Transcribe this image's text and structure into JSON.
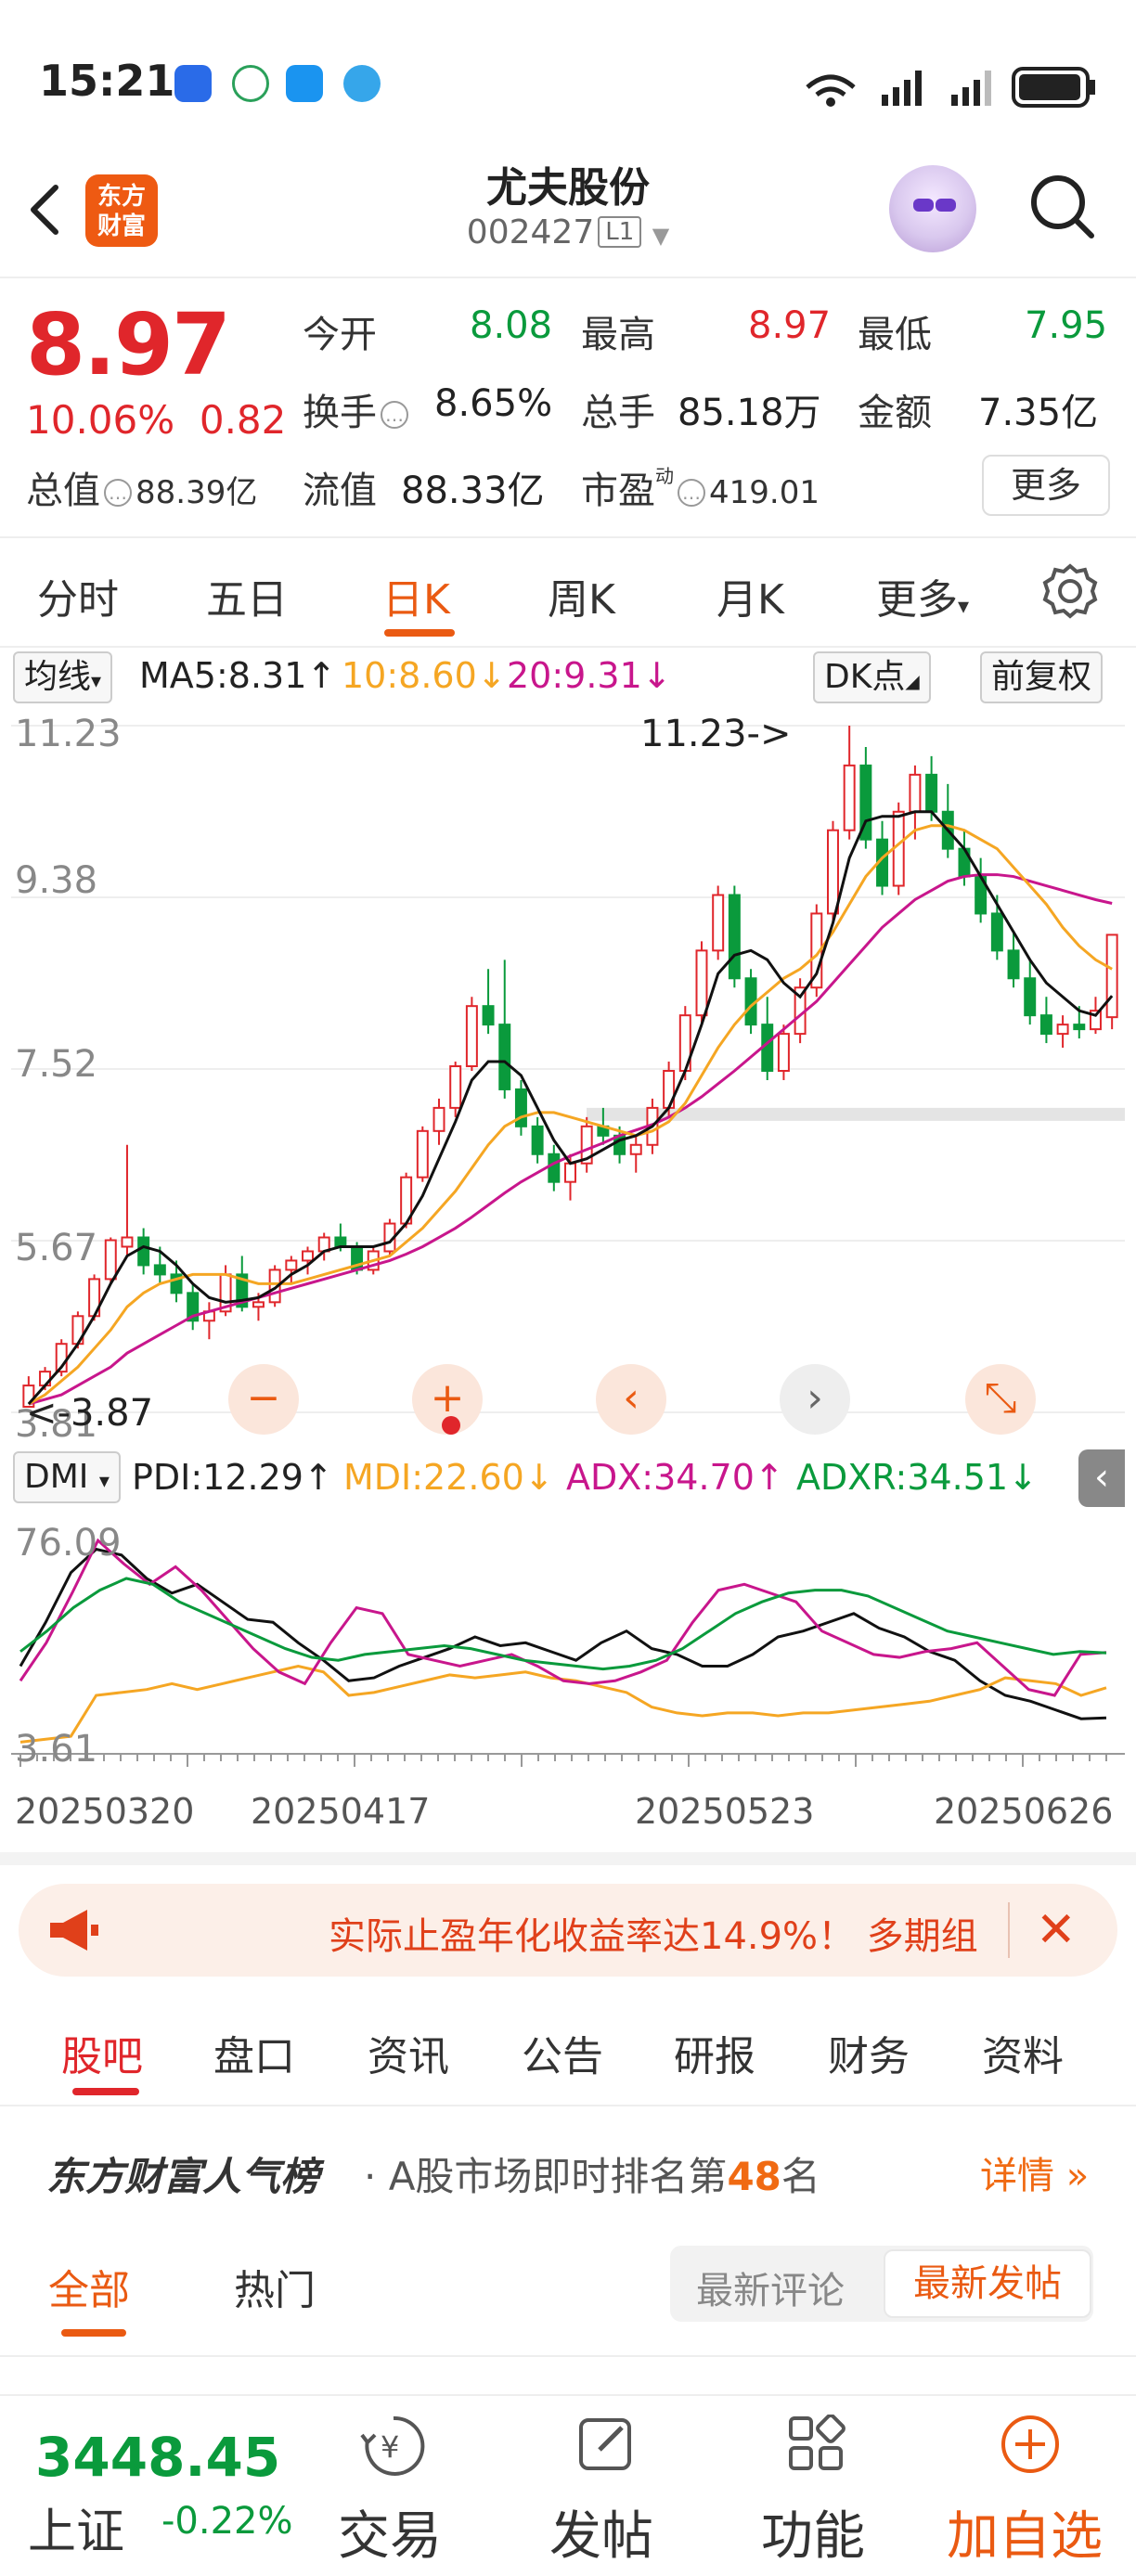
{
  "status_bar": {
    "time": "15:21"
  },
  "nav": {
    "title": "尤夫股份",
    "code": "002427",
    "level": "L1",
    "logo_text": "东方财富"
  },
  "quote": {
    "price": "8.97",
    "change_pct": "10.06%",
    "change": "0.82",
    "open_label": "今开",
    "open": "8.08",
    "high_label": "最高",
    "high": "8.97",
    "low_label": "最低",
    "low": "7.95",
    "turnover_label": "换手",
    "turnover": "8.65%",
    "volume_label": "总手",
    "volume": "85.18万",
    "amount_label": "金额",
    "amount": "7.35亿",
    "total_mv_label": "总值",
    "total_mv": "88.39亿",
    "float_mv_label": "流值",
    "float_mv": "88.33亿",
    "pe_label": "市盈",
    "pe_sup": "动",
    "pe": "419.01",
    "more_label": "更多"
  },
  "period_tabs": [
    "分时",
    "五日",
    "日K",
    "周K",
    "月K",
    "更多"
  ],
  "active_period": "日K",
  "ma_bar": {
    "selector": "均线",
    "ma5": "MA5:8.31",
    "ma10": "10:8.60",
    "ma20": "20:9.31",
    "dk": "DK点",
    "fq": "前复权"
  },
  "colors": {
    "ma5": "#111111",
    "ma10": "#f5a623",
    "ma20": "#c8168c",
    "up": "#e0262b",
    "down": "#0a9a3c",
    "accent": "#ea5a12"
  },
  "chart_data": [
    {
      "type": "candlestick",
      "y_ticks": [
        "11.23",
        "9.38",
        "7.52",
        "5.67",
        "3.81"
      ],
      "ylim": [
        3.81,
        11.23
      ],
      "annotations": {
        "max": "11.23->",
        "min": "<-3.87"
      },
      "ohlc": [
        [
          3.87,
          4.2,
          3.87,
          4.1
        ],
        [
          4.1,
          4.3,
          4.05,
          4.25
        ],
        [
          4.25,
          4.6,
          4.2,
          4.55
        ],
        [
          4.55,
          4.9,
          4.5,
          4.85
        ],
        [
          4.85,
          5.3,
          4.8,
          5.25
        ],
        [
          5.25,
          5.7,
          5.2,
          5.67
        ],
        [
          5.6,
          6.7,
          5.5,
          5.7
        ],
        [
          5.7,
          5.8,
          5.3,
          5.4
        ],
        [
          5.4,
          5.6,
          5.2,
          5.3
        ],
        [
          5.3,
          5.45,
          5.0,
          5.1
        ],
        [
          5.1,
          5.2,
          4.7,
          4.8
        ],
        [
          4.8,
          5.0,
          4.6,
          4.9
        ],
        [
          4.9,
          5.4,
          4.85,
          5.3
        ],
        [
          5.3,
          5.5,
          4.9,
          4.95
        ],
        [
          4.95,
          5.1,
          4.8,
          5.0
        ],
        [
          5.0,
          5.4,
          4.95,
          5.35
        ],
        [
          5.35,
          5.5,
          5.2,
          5.45
        ],
        [
          5.45,
          5.6,
          5.3,
          5.55
        ],
        [
          5.55,
          5.75,
          5.45,
          5.7
        ],
        [
          5.7,
          5.85,
          5.55,
          5.6
        ],
        [
          5.6,
          5.65,
          5.3,
          5.35
        ],
        [
          5.35,
          5.6,
          5.3,
          5.55
        ],
        [
          5.55,
          5.9,
          5.5,
          5.85
        ],
        [
          5.85,
          6.4,
          5.8,
          6.35
        ],
        [
          6.35,
          6.9,
          6.3,
          6.85
        ],
        [
          6.85,
          7.2,
          6.7,
          7.1
        ],
        [
          7.1,
          7.6,
          7.0,
          7.55
        ],
        [
          7.55,
          8.3,
          7.5,
          8.2
        ],
        [
          8.2,
          8.6,
          7.9,
          8.0
        ],
        [
          8.0,
          8.7,
          7.2,
          7.3
        ],
        [
          7.3,
          7.4,
          6.8,
          6.9
        ],
        [
          6.9,
          7.0,
          6.5,
          6.6
        ],
        [
          6.6,
          6.7,
          6.2,
          6.3
        ],
        [
          6.3,
          6.6,
          6.1,
          6.5
        ],
        [
          6.5,
          7.0,
          6.4,
          6.9
        ],
        [
          6.9,
          7.1,
          6.7,
          6.8
        ],
        [
          6.8,
          6.9,
          6.5,
          6.6
        ],
        [
          6.6,
          6.8,
          6.4,
          6.7
        ],
        [
          6.7,
          7.2,
          6.6,
          7.1
        ],
        [
          7.1,
          7.6,
          7.0,
          7.5
        ],
        [
          7.5,
          8.2,
          7.4,
          8.1
        ],
        [
          8.1,
          8.9,
          8.0,
          8.8
        ],
        [
          8.8,
          9.5,
          8.7,
          9.4
        ],
        [
          9.4,
          9.5,
          8.4,
          8.5
        ],
        [
          8.5,
          8.6,
          7.9,
          8.0
        ],
        [
          8.0,
          8.3,
          7.4,
          7.5
        ],
        [
          7.5,
          8.0,
          7.4,
          7.9
        ],
        [
          7.9,
          8.5,
          7.8,
          8.4
        ],
        [
          8.4,
          9.3,
          8.3,
          9.2
        ],
        [
          9.2,
          10.2,
          9.1,
          10.1
        ],
        [
          10.1,
          11.23,
          10.0,
          10.8
        ],
        [
          10.8,
          11.0,
          9.9,
          10.0
        ],
        [
          10.0,
          10.2,
          9.4,
          9.5
        ],
        [
          9.5,
          10.4,
          9.4,
          10.3
        ],
        [
          10.3,
          10.8,
          10.0,
          10.7
        ],
        [
          10.7,
          10.9,
          10.2,
          10.3
        ],
        [
          10.3,
          10.6,
          9.8,
          9.9
        ],
        [
          9.9,
          10.1,
          9.5,
          9.6
        ],
        [
          9.6,
          9.8,
          9.1,
          9.2
        ],
        [
          9.2,
          9.4,
          8.7,
          8.8
        ],
        [
          8.8,
          9.0,
          8.4,
          8.5
        ],
        [
          8.5,
          8.7,
          8.0,
          8.1
        ],
        [
          8.1,
          8.3,
          7.8,
          7.9
        ],
        [
          7.9,
          8.1,
          7.75,
          8.0
        ],
        [
          8.0,
          8.2,
          7.85,
          7.95
        ],
        [
          7.95,
          8.3,
          7.9,
          8.15
        ],
        [
          8.08,
          8.97,
          7.95,
          8.97
        ]
      ],
      "ma5": [
        3.9,
        4.1,
        4.3,
        4.55,
        4.85,
        5.2,
        5.5,
        5.6,
        5.55,
        5.4,
        5.2,
        5.05,
        5.0,
        5.02,
        5.05,
        5.15,
        5.3,
        5.4,
        5.55,
        5.6,
        5.6,
        5.6,
        5.65,
        5.85,
        6.15,
        6.55,
        6.95,
        7.4,
        7.6,
        7.6,
        7.45,
        7.1,
        6.75,
        6.5,
        6.55,
        6.65,
        6.75,
        6.8,
        6.9,
        7.1,
        7.5,
        8.0,
        8.55,
        8.75,
        8.8,
        8.7,
        8.45,
        8.3,
        8.55,
        9.1,
        9.8,
        10.2,
        10.25,
        10.25,
        10.3,
        10.3,
        10.1,
        9.9,
        9.6,
        9.3,
        9.0,
        8.7,
        8.45,
        8.3,
        8.15,
        8.1,
        8.31
      ],
      "ma10": [
        3.9,
        4.0,
        4.15,
        4.3,
        4.5,
        4.7,
        4.95,
        5.1,
        5.2,
        5.25,
        5.3,
        5.3,
        5.3,
        5.25,
        5.2,
        5.2,
        5.2,
        5.25,
        5.3,
        5.35,
        5.4,
        5.45,
        5.5,
        5.65,
        5.8,
        6.0,
        6.2,
        6.45,
        6.7,
        6.9,
        7.0,
        7.05,
        7.05,
        7.0,
        6.95,
        6.9,
        6.85,
        6.8,
        6.85,
        6.95,
        7.15,
        7.45,
        7.75,
        8.0,
        8.2,
        8.35,
        8.5,
        8.6,
        8.75,
        9.0,
        9.3,
        9.6,
        9.8,
        9.95,
        10.1,
        10.15,
        10.15,
        10.1,
        10.0,
        9.9,
        9.7,
        9.5,
        9.3,
        9.05,
        8.85,
        8.7,
        8.6
      ],
      "ma20": [
        3.9,
        3.95,
        4.0,
        4.1,
        4.2,
        4.3,
        4.45,
        4.55,
        4.65,
        4.75,
        4.85,
        4.9,
        4.95,
        5.0,
        5.05,
        5.1,
        5.15,
        5.2,
        5.25,
        5.3,
        5.35,
        5.4,
        5.45,
        5.52,
        5.6,
        5.7,
        5.8,
        5.92,
        6.05,
        6.18,
        6.3,
        6.4,
        6.5,
        6.58,
        6.65,
        6.72,
        6.8,
        6.86,
        6.92,
        7.0,
        7.1,
        7.22,
        7.36,
        7.5,
        7.65,
        7.8,
        7.95,
        8.1,
        8.25,
        8.45,
        8.65,
        8.85,
        9.05,
        9.2,
        9.35,
        9.45,
        9.55,
        9.6,
        9.62,
        9.62,
        9.6,
        9.55,
        9.5,
        9.45,
        9.4,
        9.35,
        9.31
      ]
    },
    {
      "type": "line",
      "indicator": "DMI",
      "y_ticks": [
        "76.09",
        "3.61"
      ],
      "ylim": [
        3.61,
        76.09
      ],
      "series": [
        {
          "name": "PDI:12.29",
          "values": [
            30,
            45,
            62,
            70,
            68,
            60,
            55,
            58,
            52,
            46,
            45,
            38,
            32,
            25,
            26,
            30,
            33,
            36,
            40,
            37,
            38,
            35,
            32,
            38,
            42,
            36,
            34,
            30,
            30,
            34,
            40,
            42,
            45,
            48,
            43,
            40,
            35,
            32,
            25,
            20,
            18,
            15,
            12,
            12.29
          ]
        },
        {
          "name": "MDI:22.60",
          "values": [
            4,
            5,
            6,
            20,
            21,
            22,
            24,
            22,
            24,
            26,
            28,
            30,
            28,
            20,
            21,
            23,
            25,
            27,
            26,
            27,
            28,
            26,
            25,
            23,
            21,
            16,
            14,
            13,
            14,
            14,
            13,
            14,
            14,
            15,
            16,
            17,
            18,
            20,
            22,
            26,
            25,
            24,
            20,
            22.6
          ]
        },
        {
          "name": "ADX:34.70",
          "values": [
            25,
            38,
            55,
            73,
            65,
            58,
            64,
            56,
            46,
            36,
            28,
            24,
            38,
            50,
            48,
            34,
            32,
            30,
            32,
            34,
            30,
            25,
            24,
            25,
            28,
            32,
            45,
            56,
            58,
            55,
            52,
            42,
            38,
            34,
            33,
            35,
            36,
            38,
            30,
            22,
            20,
            34,
            34.7
          ]
        },
        {
          "name": "ADXR:34.51",
          "values": [
            35,
            42,
            50,
            56,
            60,
            58,
            52,
            48,
            44,
            40,
            36,
            33,
            32,
            34,
            35,
            36,
            37,
            36,
            34,
            32,
            31,
            30,
            29,
            30,
            32,
            36,
            42,
            48,
            52,
            55,
            56,
            56,
            54,
            50,
            46,
            42,
            40,
            38,
            36,
            34,
            35,
            34.51
          ]
        }
      ],
      "x_labels": [
        "20250320",
        "20250417",
        "20250523",
        "20250626"
      ]
    }
  ],
  "dmi_bar": {
    "selector": "DMI",
    "pdi": "PDI:12.29",
    "mdi": "MDI:22.60",
    "adx": "ADX:34.70",
    "adxr": "ADXR:34.51"
  },
  "banner": {
    "text": "实际止盈年化收益率达14.9%！ 多期组"
  },
  "section_tabs": [
    "股吧",
    "盘口",
    "资讯",
    "公告",
    "研报",
    "财务",
    "资料"
  ],
  "active_section": "股吧",
  "rank": {
    "brand": "东方财富人气榜",
    "text_before": "· A股市场即时排名第",
    "rank_no": "48",
    "text_after": "名",
    "detail": "详情"
  },
  "filter_tabs": {
    "all": "全部",
    "hot": "热门",
    "latest_comment": "最新评论",
    "latest_post": "最新发帖"
  },
  "bottom_bar": {
    "index_value": "3448.45",
    "index_name": "上证",
    "index_change": "-0.22%",
    "items": [
      "交易",
      "发帖",
      "功能",
      "加自选"
    ]
  }
}
